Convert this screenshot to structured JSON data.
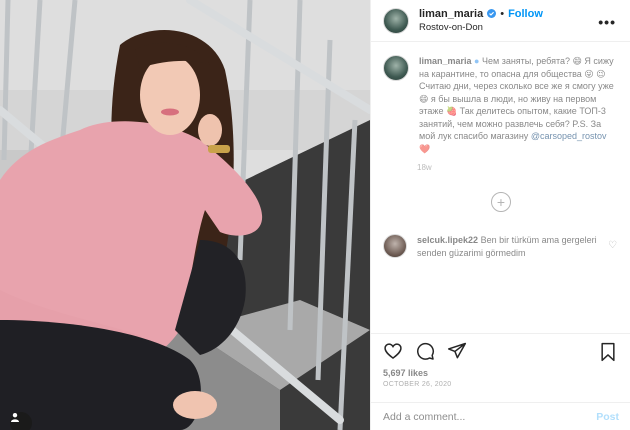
{
  "post": {
    "username": "liman_maria",
    "follow_label": "Follow",
    "location": "Rostov-on-Don",
    "dot": "•",
    "more_glyph": "•••"
  },
  "caption": {
    "username": "liman_maria",
    "text": "Чем заняты, ребята? 😄 Я сижу на карантине, то опасна для общества 😜 😉 Считаю дни, через сколько все же я смогу уже 😄 я бы вышла в люди, но живу на первом этаже 🍓 Так делитесь опытом, какие ТОП-3 занятий, чем можно развлечь себя? P.S. За мой лук спасибо магазину",
    "link": "@carsoped_rostov",
    "heart": "❤️",
    "time": "18w"
  },
  "load_more_glyph": "+",
  "comment": {
    "username": "selcuk.lipek22",
    "text": "Ben bir türküm ama gergeleri senden güzarimi görmedim",
    "heart_glyph": "♡"
  },
  "actions": {
    "likes": "5,697 likes",
    "date": "OCTOBER 26, 2020"
  },
  "comment_box": {
    "placeholder": "Add a comment...",
    "post_label": "Post"
  },
  "colors": {
    "accent": "#0095f6",
    "post_disabled": "#b2dffc",
    "text": "#262626",
    "muted": "#8e8e8e",
    "divider": "#efefef"
  }
}
